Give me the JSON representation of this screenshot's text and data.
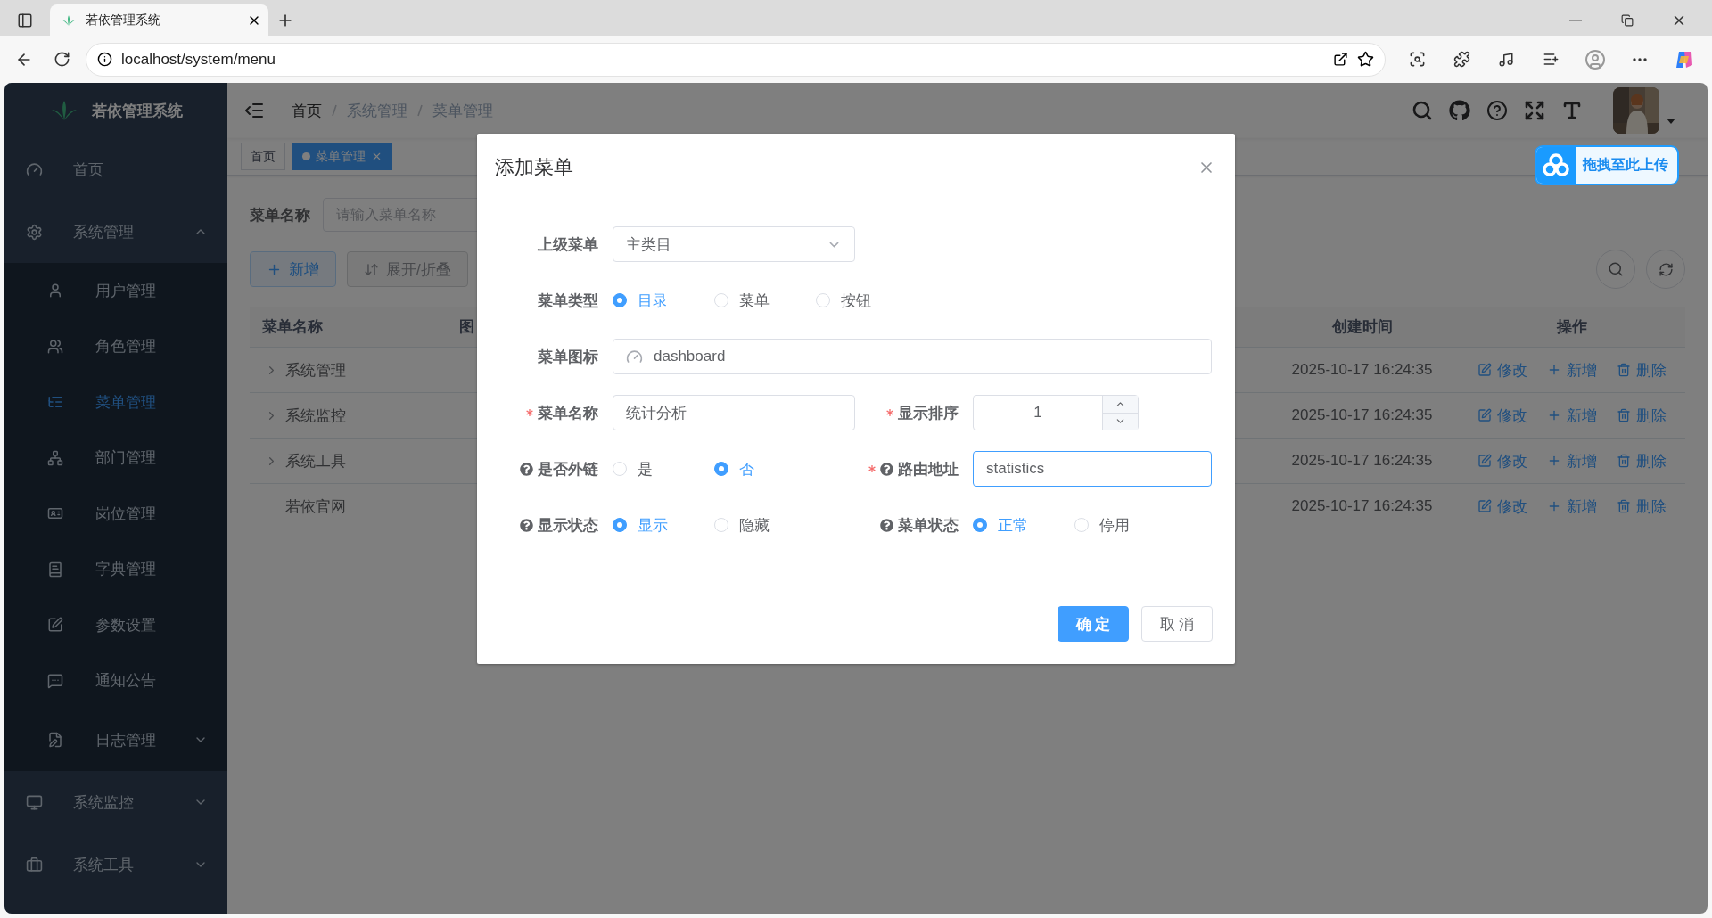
{
  "browser": {
    "tab_title": "若依管理系统",
    "url": "localhost/system/menu"
  },
  "sidebar": {
    "title": "若依管理系统",
    "items": [
      {
        "label": "首页",
        "selected": false
      },
      {
        "label": "系统管理",
        "selected": false,
        "expanded": true,
        "children": [
          {
            "label": "用户管理",
            "selected": false
          },
          {
            "label": "角色管理",
            "selected": false
          },
          {
            "label": "菜单管理",
            "selected": true
          },
          {
            "label": "部门管理",
            "selected": false
          },
          {
            "label": "岗位管理",
            "selected": false
          },
          {
            "label": "字典管理",
            "selected": false
          },
          {
            "label": "参数设置",
            "selected": false
          },
          {
            "label": "通知公告",
            "selected": false
          },
          {
            "label": "日志管理",
            "selected": false,
            "expanded": false
          }
        ]
      },
      {
        "label": "系统监控",
        "selected": false,
        "expanded": false
      },
      {
        "label": "系统工具",
        "selected": false,
        "expanded": false
      }
    ]
  },
  "header": {
    "breadcrumb": [
      "首页",
      "系统管理",
      "菜单管理"
    ]
  },
  "tags": [
    {
      "label": "首页",
      "selected": false
    },
    {
      "label": "菜单管理",
      "selected": true
    }
  ],
  "search": {
    "label": "菜单名称",
    "placeholder": "请输入菜单名称"
  },
  "toolbar": [
    {
      "label": "新增",
      "kind": "primary"
    },
    {
      "label": "展开/折叠",
      "kind": "info"
    }
  ],
  "table": {
    "columns": [
      "菜单名称",
      "图",
      "创建时间",
      "操作"
    ],
    "rows": [
      {
        "name": "系统管理",
        "expandable": true,
        "created": "2025-10-17 16:24:35",
        "actions": [
          "修改",
          "新增",
          "删除"
        ]
      },
      {
        "name": "系统监控",
        "expandable": true,
        "created": "2025-10-17 16:24:35",
        "actions": [
          "修改",
          "新增",
          "删除"
        ]
      },
      {
        "name": "系统工具",
        "expandable": true,
        "created": "2025-10-17 16:24:35",
        "actions": [
          "修改",
          "新增",
          "删除"
        ]
      },
      {
        "name": "若依官网",
        "expandable": false,
        "created": "2025-10-17 16:24:35",
        "actions": [
          "修改",
          "新增",
          "删除"
        ]
      }
    ]
  },
  "dialog": {
    "title": "添加菜单",
    "rows": [
      [
        {
          "kind": "select",
          "label": "上级菜单",
          "required": false,
          "help": false,
          "focused": false,
          "value": "主类目"
        }
      ],
      [
        {
          "kind": "radio",
          "label": "菜单类型",
          "required": false,
          "help": false,
          "options": [
            {
              "label": "目录",
              "selected": true
            },
            {
              "label": "菜单",
              "selected": false
            },
            {
              "label": "按钮",
              "selected": false
            }
          ]
        }
      ],
      [
        {
          "kind": "icon-input",
          "label": "菜单图标",
          "required": false,
          "help": false,
          "focused": false,
          "value": "dashboard"
        }
      ],
      [
        {
          "kind": "text",
          "label": "菜单名称",
          "required": true,
          "help": false,
          "focused": false,
          "value": "统计分析"
        },
        {
          "kind": "number",
          "label": "显示排序",
          "required": true,
          "help": false,
          "focused": false,
          "value": "1"
        }
      ],
      [
        {
          "kind": "radio",
          "label": "是否外链",
          "required": false,
          "help": true,
          "options": [
            {
              "label": "是",
              "selected": false
            },
            {
              "label": "否",
              "selected": true
            }
          ]
        },
        {
          "kind": "text",
          "label": "路由地址",
          "required": true,
          "help": true,
          "focused": true,
          "value": "statistics"
        }
      ],
      [
        {
          "kind": "radio",
          "label": "显示状态",
          "required": false,
          "help": true,
          "options": [
            {
              "label": "显示",
              "selected": true
            },
            {
              "label": "隐藏",
              "selected": false
            }
          ]
        },
        {
          "kind": "radio",
          "label": "菜单状态",
          "required": false,
          "help": true,
          "options": [
            {
              "label": "正常",
              "selected": true
            },
            {
              "label": "停用",
              "selected": false
            }
          ]
        }
      ]
    ],
    "buttons": [
      {
        "label": "确 定",
        "kind": "primary"
      },
      {
        "label": "取 消",
        "kind": "default"
      }
    ]
  },
  "upload_widget": {
    "label": "拖拽至此上传"
  }
}
